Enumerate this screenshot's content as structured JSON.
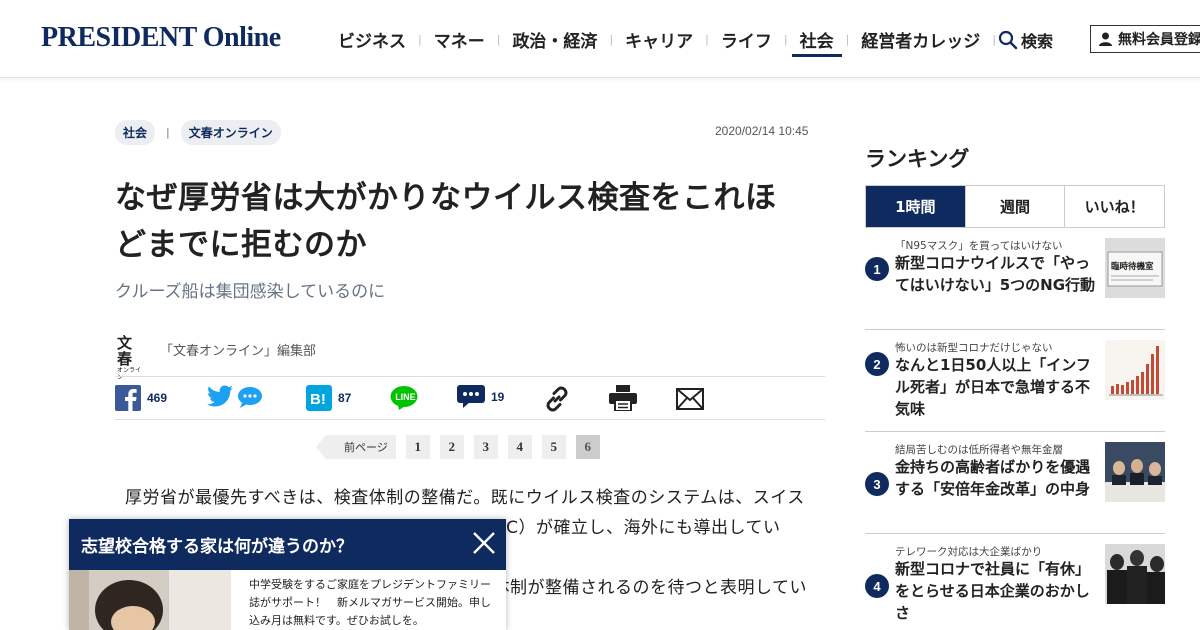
{
  "header": {
    "logo": "PRESIDENT Online",
    "nav": [
      {
        "label": "ビジネス"
      },
      {
        "label": "マネー"
      },
      {
        "label": "政治・経済"
      },
      {
        "label": "キャリア"
      },
      {
        "label": "ライフ"
      },
      {
        "label": "社会",
        "active": true
      },
      {
        "label": "経営者カレッジ"
      }
    ],
    "search_label": "検索",
    "member_label": "無料会員登録"
  },
  "article": {
    "tags": [
      "社会",
      "文春オンライン"
    ],
    "date": "2020/02/14 10:45",
    "title_line1": "なぜ厚労省は大がかりなウイルス検査をこれほ",
    "title_line2": "どまでに拒むのか",
    "subtitle": "クルーズ船は集団感染しているのに",
    "author_logo_top": "文春",
    "author_logo_bottom": "オンライン",
    "author": "「文春オンライン」編集部",
    "share": {
      "facebook_count": "469",
      "hatena_count": "87",
      "comment_count": "19"
    },
    "pager": {
      "prev_label": "前ページ",
      "pages": [
        "1",
        "2",
        "3",
        "4",
        "5",
        "6"
      ],
      "current": "6"
    },
    "body_lines": [
      "厚労省が最優先すべきは、検査体制の整備だ。既にウイルス検査のシステムは、スイス",
      "　　　　　　　　　　　　　　　　　　　　　DC）が確立し、海外にも導出してい",
      "",
      "　　　　　　　　　　　　　　　　　　　　　体制が整備されるのを待つと表明してい"
    ]
  },
  "popup": {
    "title": "志望校合格する家は何が違うのか？",
    "text": "中学受験をするご家庭をプレジデントファミリー誌がサポート！　新メルマガサービス開始。申し込み月は無料です。ぜひお試しを。"
  },
  "ranking": {
    "title": "ランキング",
    "tabs": [
      "1時間",
      "週間",
      "いいね！"
    ],
    "active_tab": "1時間",
    "items": [
      {
        "num": "1",
        "category": "「N95マスク」を買ってはいけない",
        "headline": "新型コロナウイルスで「やってはいけない」5つのNG行動",
        "thumb_text": "臨時待機室"
      },
      {
        "num": "2",
        "category": "怖いのは新型コロナだけじゃない",
        "headline": "なんと1日50人以上「インフル死者」が日本で急増する不気味"
      },
      {
        "num": "3",
        "category": "結局苦しむのは低所得者や無年金層",
        "headline": "金持ちの高齢者ばかりを優遇する「安倍年金改革」の中身"
      },
      {
        "num": "4",
        "category": "テレワーク対応は大企業ばかり",
        "headline": "新型コロナで社員に「有休」をとらせる日本企業のおかしさ"
      }
    ]
  },
  "colors": {
    "brand_navy": "#0f2a5e",
    "tag_bg": "#eceef2",
    "facebook": "#3b5998",
    "twitter": "#1da1f2",
    "hatena": "#00a4de",
    "line": "#00c300"
  }
}
